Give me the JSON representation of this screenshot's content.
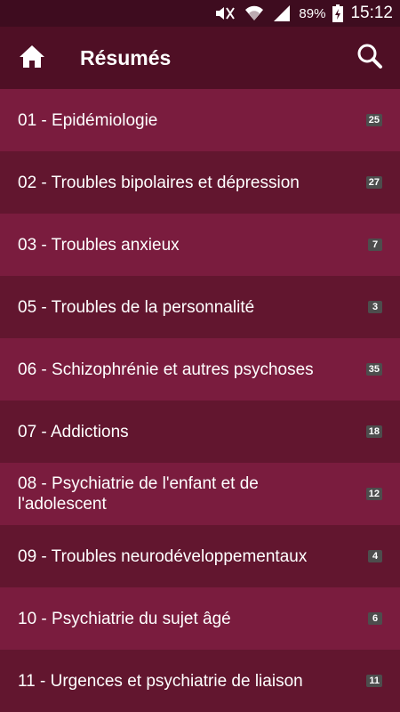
{
  "status_bar": {
    "battery_percent": "89%",
    "time": "15:12",
    "icons": [
      "mute-icon",
      "wifi-icon",
      "signal-icon",
      "battery-icon"
    ]
  },
  "app_bar": {
    "title": "Résumés",
    "home_icon": "home-icon",
    "search_icon": "search-icon"
  },
  "list": {
    "items": [
      {
        "label": "01 - Epidémiologie",
        "count": "25"
      },
      {
        "label": "02 - Troubles bipolaires et dépression",
        "count": "27"
      },
      {
        "label": "03 - Troubles anxieux",
        "count": "7"
      },
      {
        "label": "05 - Troubles de la personnalité",
        "count": "3"
      },
      {
        "label": "06 - Schizophrénie et autres psychoses",
        "count": "35"
      },
      {
        "label": "07 - Addictions",
        "count": "18"
      },
      {
        "label": "08 - Psychiatrie de l'enfant et de l'adolescent",
        "count": "12"
      },
      {
        "label": "09 - Troubles neurodéveloppementaux",
        "count": "4"
      },
      {
        "label": "10 - Psychiatrie du sujet âgé",
        "count": "6"
      },
      {
        "label": "11 - Urgences et psychiatrie de liaison",
        "count": "11"
      }
    ]
  },
  "colors": {
    "status_bar_bg": "#3e0c1f",
    "app_bar_bg": "#4f0f25",
    "row_light": "#7a1c3e",
    "row_dark": "#62162f",
    "badge_bg": "#4d4d4d"
  }
}
